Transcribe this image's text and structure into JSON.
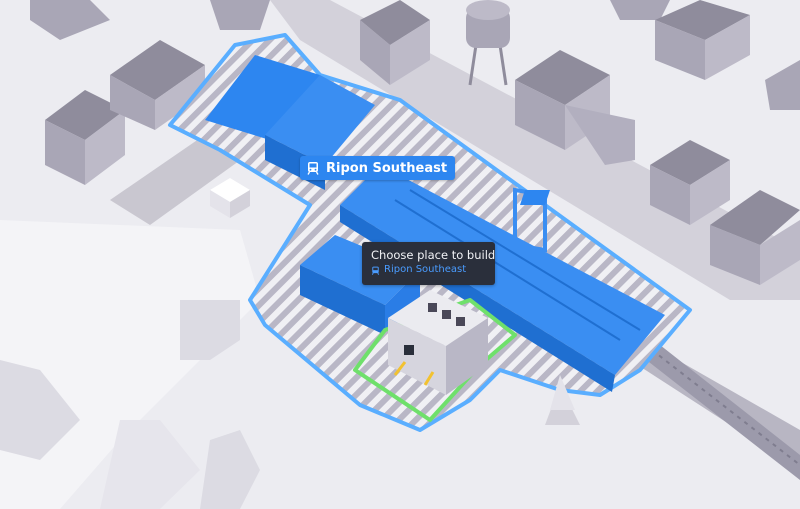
{
  "station_label": {
    "name": "Ripon Southeast",
    "icon": "train-icon"
  },
  "tooltip": {
    "title": "Choose place to build",
    "station_name": "Ripon Southeast",
    "icon": "train-icon"
  },
  "colors": {
    "ground": "#ececf1",
    "building": "#a9a6b6",
    "road": "#c9c7d0",
    "station_blue": "#2d86f0",
    "zone_outline": "#5aaeff",
    "placement_green": "#6fe06b",
    "tooltip_bg": "#2a2f3b",
    "tooltip_link": "#4a9cff"
  }
}
